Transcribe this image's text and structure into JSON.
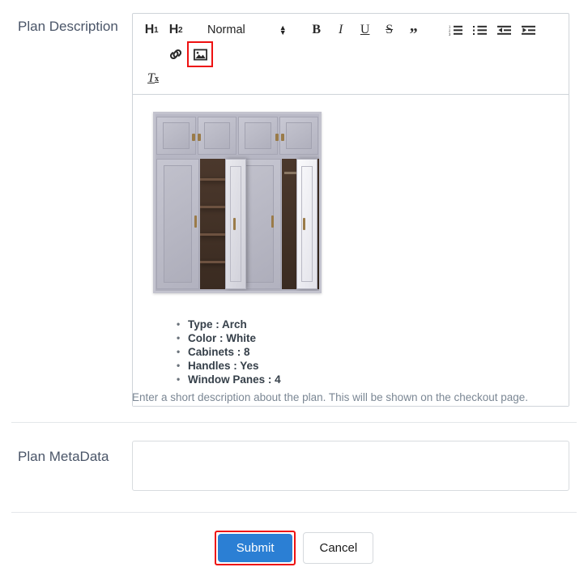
{
  "form": {
    "description_label": "Plan Description",
    "metadata_label": "Plan MetaData",
    "helper_text": "Enter a short description about the plan. This will be shown on the checkout page.",
    "metadata_value": "",
    "metadata_placeholder": ""
  },
  "toolbar": {
    "h1_letter": "H",
    "h1_num": "1",
    "h2_letter": "H",
    "h2_num": "2",
    "format_select": "Normal",
    "bold": "B",
    "italic": "I",
    "underline": "U",
    "strike": "S",
    "quote": "”",
    "clear_letter": "T",
    "clear_sub": "x",
    "icons": {
      "ordered_list": "ordered-list-icon",
      "bullet_list": "bullet-list-icon",
      "outdent": "outdent-icon",
      "indent": "indent-icon",
      "link": "link-icon",
      "image": "image-icon"
    }
  },
  "editor_content": {
    "image_alt": "White arch wardrobe with eight cabinets and two open doors showing wooden shelving",
    "specs": [
      "Type : Arch",
      "Color : White",
      "Cabinets : 8",
      "Handles : Yes",
      "Window Panes : 4"
    ]
  },
  "footer": {
    "submit_label": "Submit",
    "cancel_label": "Cancel"
  },
  "colors": {
    "submit_blue": "#2b7fd4",
    "highlight_red": "#ee1111",
    "label_text": "#4a5568",
    "helper_text": "#7b8794",
    "border": "#cfd4d9"
  }
}
